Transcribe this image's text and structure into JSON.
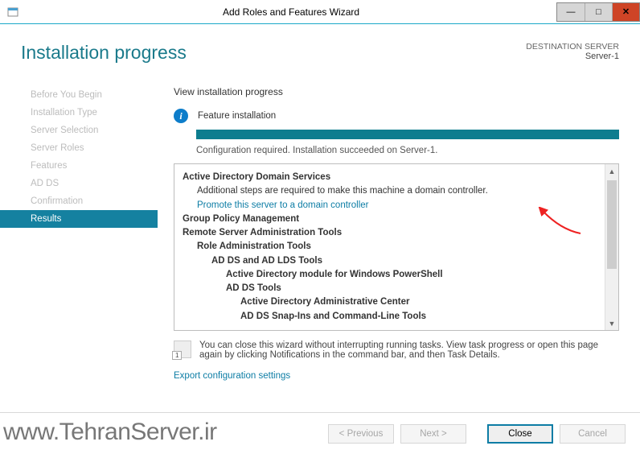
{
  "window": {
    "title": "Add Roles and Features Wizard"
  },
  "header": {
    "title": "Installation progress",
    "dest_label": "DESTINATION SERVER",
    "dest_server": "Server-1"
  },
  "sidebar": {
    "items": [
      "Before You Begin",
      "Installation Type",
      "Server Selection",
      "Server Roles",
      "Features",
      "AD DS",
      "Confirmation",
      "Results"
    ],
    "active_index": 7
  },
  "main": {
    "subhead": "View installation progress",
    "feature_label": "Feature installation",
    "status": "Configuration required. Installation succeeded on Server-1.",
    "details": {
      "adds": "Active Directory Domain Services",
      "adds_note": "Additional steps are required to make this machine a domain controller.",
      "promote_link": "Promote this server to a domain controller",
      "gpm": "Group Policy Management",
      "rsat": "Remote Server Administration Tools",
      "rat": "Role Administration Tools",
      "adlds": "AD DS and AD LDS Tools",
      "admps": "Active Directory module for Windows PowerShell",
      "addst": "AD DS Tools",
      "adac": "Active Directory Administrative Center",
      "snapins": "AD DS Snap-Ins and Command-Line Tools"
    },
    "note": "You can close this wizard without interrupting running tasks. View task progress or open this page again by clicking Notifications in the command bar, and then Task Details.",
    "export_link": "Export configuration settings"
  },
  "footer": {
    "previous": "< Previous",
    "next": "Next >",
    "close": "Close",
    "cancel": "Cancel"
  },
  "watermark": "www.TehranServer.ir"
}
